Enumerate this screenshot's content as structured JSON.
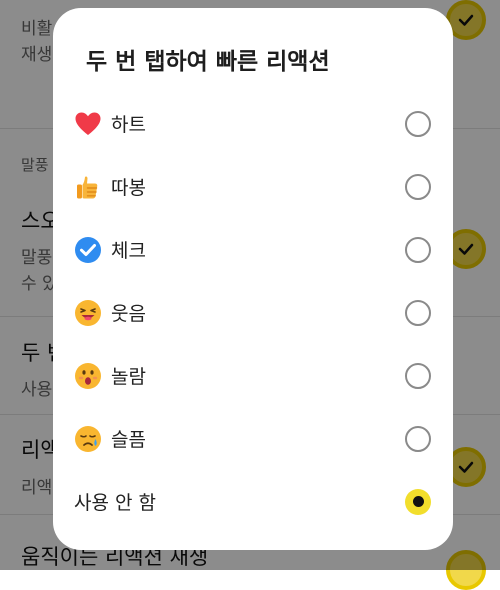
{
  "background": {
    "items": [
      {
        "text": "비활"
      },
      {
        "text": "재생"
      },
      {
        "text": "말풍"
      },
      {
        "text": "스오"
      },
      {
        "text": "말풍"
      },
      {
        "text": "수 있"
      },
      {
        "text": "두 번"
      },
      {
        "text": "사용"
      },
      {
        "text": "리액"
      },
      {
        "text": "리액"
      },
      {
        "text": "움직이는 리액션 재생"
      }
    ]
  },
  "dialog": {
    "title": "두 번 탭하여 빠른 리액션",
    "options": [
      {
        "label": "하트",
        "icon": "heart-emoji-icon",
        "selected": false
      },
      {
        "label": "따봉",
        "icon": "thumbs-up-emoji-icon",
        "selected": false
      },
      {
        "label": "체크",
        "icon": "check-emoji-icon",
        "selected": false
      },
      {
        "label": "웃음",
        "icon": "laughing-face-emoji-icon",
        "selected": false
      },
      {
        "label": "놀람",
        "icon": "surprised-face-emoji-icon",
        "selected": false
      },
      {
        "label": "슬픔",
        "icon": "crying-face-emoji-icon",
        "selected": false
      },
      {
        "label": "사용 안 함",
        "icon": "",
        "selected": true
      }
    ]
  },
  "colors": {
    "accent": "#f2de2c",
    "scrim": "rgba(0,0,0,0.45)"
  }
}
